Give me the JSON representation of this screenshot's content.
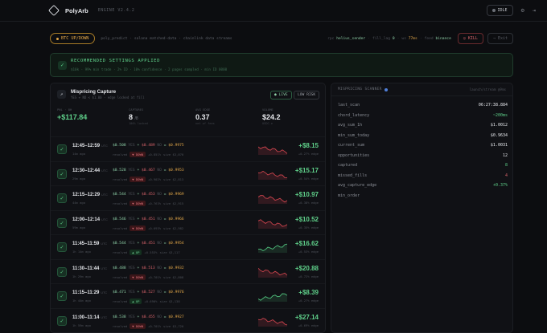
{
  "topbar": {
    "brand": "PolyArb",
    "engine": "ENGINE V2.4.2",
    "status": "IDLE"
  },
  "strip": {
    "market": "BTC UP/DOWN",
    "info": "poly_predict · solana matched-data · chainlink data streams",
    "rpc_label": "rpc",
    "rpc_value": "helius_sender",
    "fill_label": "fill_lag",
    "fill_value": "0",
    "ws_label": "ws",
    "ws_value": "77ms",
    "feed_label": "feed",
    "feed_value": "binance",
    "kill": "KILL",
    "exit": "Exit"
  },
  "recommend": {
    "title": "RECOMMENDED SETTINGS APPLIED",
    "subtitle": "$10k · 99% min trade · 2% ID · 10% confidence · 2 pages sampled · min ID 0000"
  },
  "capture": {
    "title": "Mispricing Capture",
    "subtitle": "YES + NO < $1.00 · edge locked at fill",
    "live": "LIVE",
    "risk": "LOW RISK",
    "stats": [
      {
        "label": "PNL · 8H",
        "value": "+$117.84",
        "note": ""
      },
      {
        "label": "CAPTURES",
        "value": "8",
        "unit": "/8",
        "note": "100% locked"
      },
      {
        "label": "AVG EDGE",
        "value": "0.37",
        "unit": "",
        "note": "net of fees"
      },
      {
        "label": "VOLUME",
        "value": "$24.2",
        "unit": "",
        "note": "USDC.e"
      }
    ],
    "rows": [
      {
        "time": "12:45–12:59",
        "tz": "UTC",
        "ago": "14m ago",
        "yes": "$0.508",
        "no": "$0.489",
        "sum": "$0.9975",
        "dir": "DOWN",
        "meta1": "+0.851%",
        "meta2": "size $3,070",
        "pnl": "+$8.15",
        "edge": "+0.27% edge",
        "trend": "down"
      },
      {
        "time": "12:30–12:44",
        "tz": "UTC",
        "ago": "29m ago",
        "yes": "$0.528",
        "no": "$0.467",
        "sum": "$0.9953",
        "dir": "DOWN",
        "meta1": "+0.902%",
        "meta2": "size $2,813",
        "pnl": "+$15.17",
        "edge": "+0.54% edge",
        "trend": "down"
      },
      {
        "time": "12:15–12:29",
        "tz": "UTC",
        "ago": "44m ago",
        "yes": "$0.544",
        "no": "$0.453",
        "sum": "$0.9969",
        "dir": "DOWN",
        "meta1": "+0.763%",
        "meta2": "size $2,915",
        "pnl": "+$10.97",
        "edge": "+0.38% edge",
        "trend": "down"
      },
      {
        "time": "12:00–12:14",
        "tz": "UTC",
        "ago": "59m ago",
        "yes": "$0.546",
        "no": "$0.451",
        "sum": "$0.9966",
        "dir": "DOWN",
        "meta1": "+0.693%",
        "meta2": "size $2,982",
        "pnl": "+$10.52",
        "edge": "+0.35% edge",
        "trend": "down"
      },
      {
        "time": "11:45–11:59",
        "tz": "UTC",
        "ago": "1h 14m ago",
        "yes": "$0.544",
        "no": "$0.451",
        "sum": "$0.9954",
        "dir": "UP",
        "meta1": "+0.553%",
        "meta2": "size $3,117",
        "pnl": "+$16.62",
        "edge": "+0.53% edge",
        "trend": "up"
      },
      {
        "time": "11:30–11:44",
        "tz": "UTC",
        "ago": "1h 29m ago",
        "yes": "$0.488",
        "no": "$0.513",
        "sum": "$0.9932",
        "dir": "DOWN",
        "meta1": "+0.701%",
        "meta2": "size $2,808",
        "pnl": "+$20.88",
        "edge": "+0.72% edge",
        "trend": "down"
      },
      {
        "time": "11:15–11:29",
        "tz": "UTC",
        "ago": "1h 44m ago",
        "yes": "$0.471",
        "no": "$0.527",
        "sum": "$0.9976",
        "dir": "UP",
        "meta1": "+0.690%",
        "meta2": "size $3,138",
        "pnl": "+$8.39",
        "edge": "+0.27% edge",
        "trend": "up"
      },
      {
        "time": "11:00–11:14",
        "tz": "UTC",
        "ago": "1h 59m ago",
        "yes": "$0.538",
        "no": "$0.455",
        "sum": "$0.9927",
        "dir": "DOWN",
        "meta1": "+0.701%",
        "meta2": "size $3,720",
        "pnl": "+$27.14",
        "edge": "+0.69% edge",
        "trend": "down"
      }
    ]
  },
  "scanner": {
    "title": "MISPRICING SCANNER",
    "right": "launch/stream @9ms",
    "fields": [
      {
        "key": "last_scan",
        "value": "06:27:38.884",
        "tone": ""
      },
      {
        "key": "chord_latency",
        "value": "~200ms",
        "tone": "g"
      },
      {
        "key": "avg_sum_1h",
        "value": "$1.0012",
        "tone": ""
      },
      {
        "key": "min_sum_today",
        "value": "$0.9634",
        "tone": ""
      },
      {
        "key": "current_sum",
        "value": "$1.0031",
        "tone": ""
      },
      {
        "key": "opportunities",
        "value": "12",
        "tone": ""
      },
      {
        "key": "captured",
        "value": "8",
        "tone": "g"
      },
      {
        "key": "missed_fills",
        "value": "4",
        "tone": "r"
      },
      {
        "key": "avg_capture_edge",
        "value": "+0.37%",
        "tone": "g"
      },
      {
        "key": "min_order",
        "value": "",
        "tone": ""
      }
    ]
  }
}
